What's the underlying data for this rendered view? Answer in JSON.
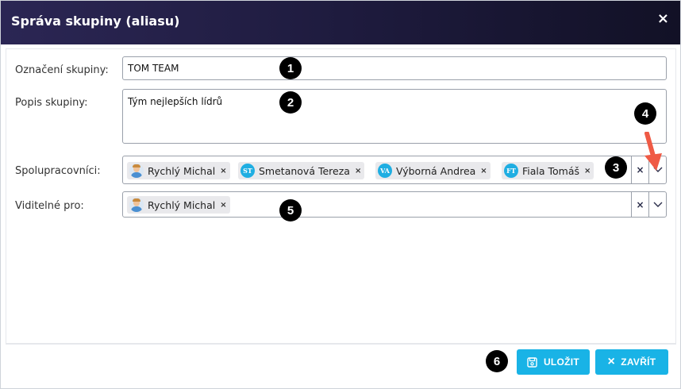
{
  "dialog": {
    "title": "Správa skupiny (aliasu)",
    "close_glyph": "×"
  },
  "form": {
    "group_name_label": "Označení skupiny:",
    "group_name_value": "TOM TEAM",
    "description_label": "Popis skupiny:",
    "description_value": "Tým nejlepších lídrů",
    "collaborators_label": "Spolupracovníci:",
    "collaborators": [
      {
        "name": "Rychlý Michal",
        "initials": "",
        "avatar": "photo"
      },
      {
        "name": "Smetanová Tereza",
        "initials": "ST",
        "avatar": "initials"
      },
      {
        "name": "Výborná Andrea",
        "initials": "VA",
        "avatar": "initials"
      },
      {
        "name": "Fiala Tomáš",
        "initials": "FT",
        "avatar": "initials"
      }
    ],
    "visible_for_label": "Viditelné pro:",
    "visible_for": [
      {
        "name": "Rychlý Michal",
        "initials": "",
        "avatar": "photo"
      }
    ],
    "chip_remove_glyph": "×",
    "clear_glyph": "×",
    "dropdown_icon": "chevron-down-icon"
  },
  "annotations": [
    "1",
    "2",
    "3",
    "4",
    "5",
    "6"
  ],
  "footer": {
    "save_label": "ULOŽIT",
    "close_label": "ZAVŘÍT",
    "close_glyph": "×"
  },
  "colors": {
    "title_bar_start": "#2b2654",
    "title_bar_end": "#121126",
    "accent": "#19b3e6",
    "annotation_arrow": "#ef5a45"
  }
}
